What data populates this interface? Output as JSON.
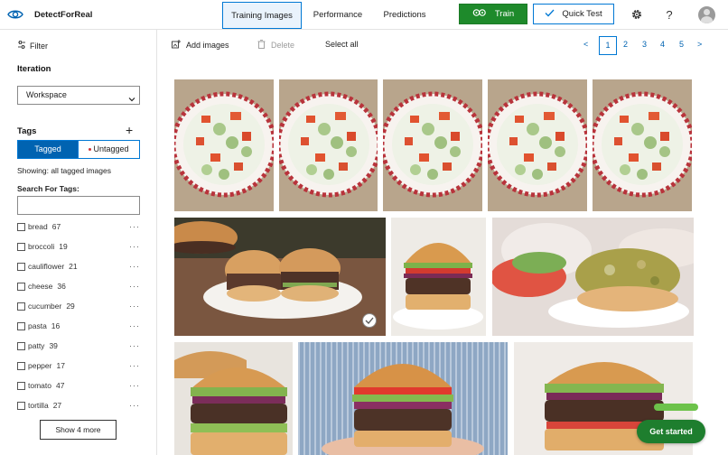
{
  "app": {
    "title": "DetectForReal",
    "icon": "eye-icon"
  },
  "nav": {
    "tabs": [
      {
        "label": "Training Images",
        "active": true
      },
      {
        "label": "Performance",
        "active": false
      },
      {
        "label": "Predictions",
        "active": false
      }
    ],
    "train_label": "Train",
    "quick_test_label": "Quick Test"
  },
  "sidebar": {
    "filter_label": "Filter",
    "iteration_heading": "Iteration",
    "iteration_value": "Workspace",
    "tags_heading": "Tags",
    "tagged_label": "Tagged",
    "untagged_label": "Untagged",
    "showing_text": "Showing: all tagged images",
    "search_label": "Search For Tags:",
    "search_value": "",
    "tags": [
      {
        "name": "bread",
        "count": "67"
      },
      {
        "name": "broccoli",
        "count": "19"
      },
      {
        "name": "cauliflower",
        "count": "21"
      },
      {
        "name": "cheese",
        "count": "36"
      },
      {
        "name": "cucumber",
        "count": "29"
      },
      {
        "name": "pasta",
        "count": "16"
      },
      {
        "name": "patty",
        "count": "39"
      },
      {
        "name": "pepper",
        "count": "17"
      },
      {
        "name": "tomato",
        "count": "47"
      },
      {
        "name": "tortilla",
        "count": "27"
      }
    ],
    "show_more_label": "Show 4 more",
    "tag_row_more": "···"
  },
  "toolbar": {
    "add_images_label": "Add images",
    "delete_label": "Delete",
    "select_all_label": "Select all"
  },
  "pagination": {
    "prev": "<",
    "pages": [
      "1",
      "2",
      "3",
      "4",
      "5"
    ],
    "current": "1",
    "next": ">"
  },
  "gallery": {
    "images": [
      {
        "subject": "salad-bowl"
      },
      {
        "subject": "salad-bowl"
      },
      {
        "subject": "salad-bowl"
      },
      {
        "subject": "salad-bowl"
      },
      {
        "subject": "salad-bowl"
      },
      {
        "subject": "halved-burger",
        "selected": true
      },
      {
        "subject": "burger"
      },
      {
        "subject": "veggie-burger"
      },
      {
        "subject": "burger"
      },
      {
        "subject": "burger-in-hand"
      },
      {
        "subject": "burger"
      }
    ]
  },
  "colors": {
    "accent": "#0078d4",
    "train_green": "#1e8a2b",
    "get_started_green": "#1e7e2e",
    "untagged_dot": "#d13438"
  },
  "get_started_label": "Get started"
}
